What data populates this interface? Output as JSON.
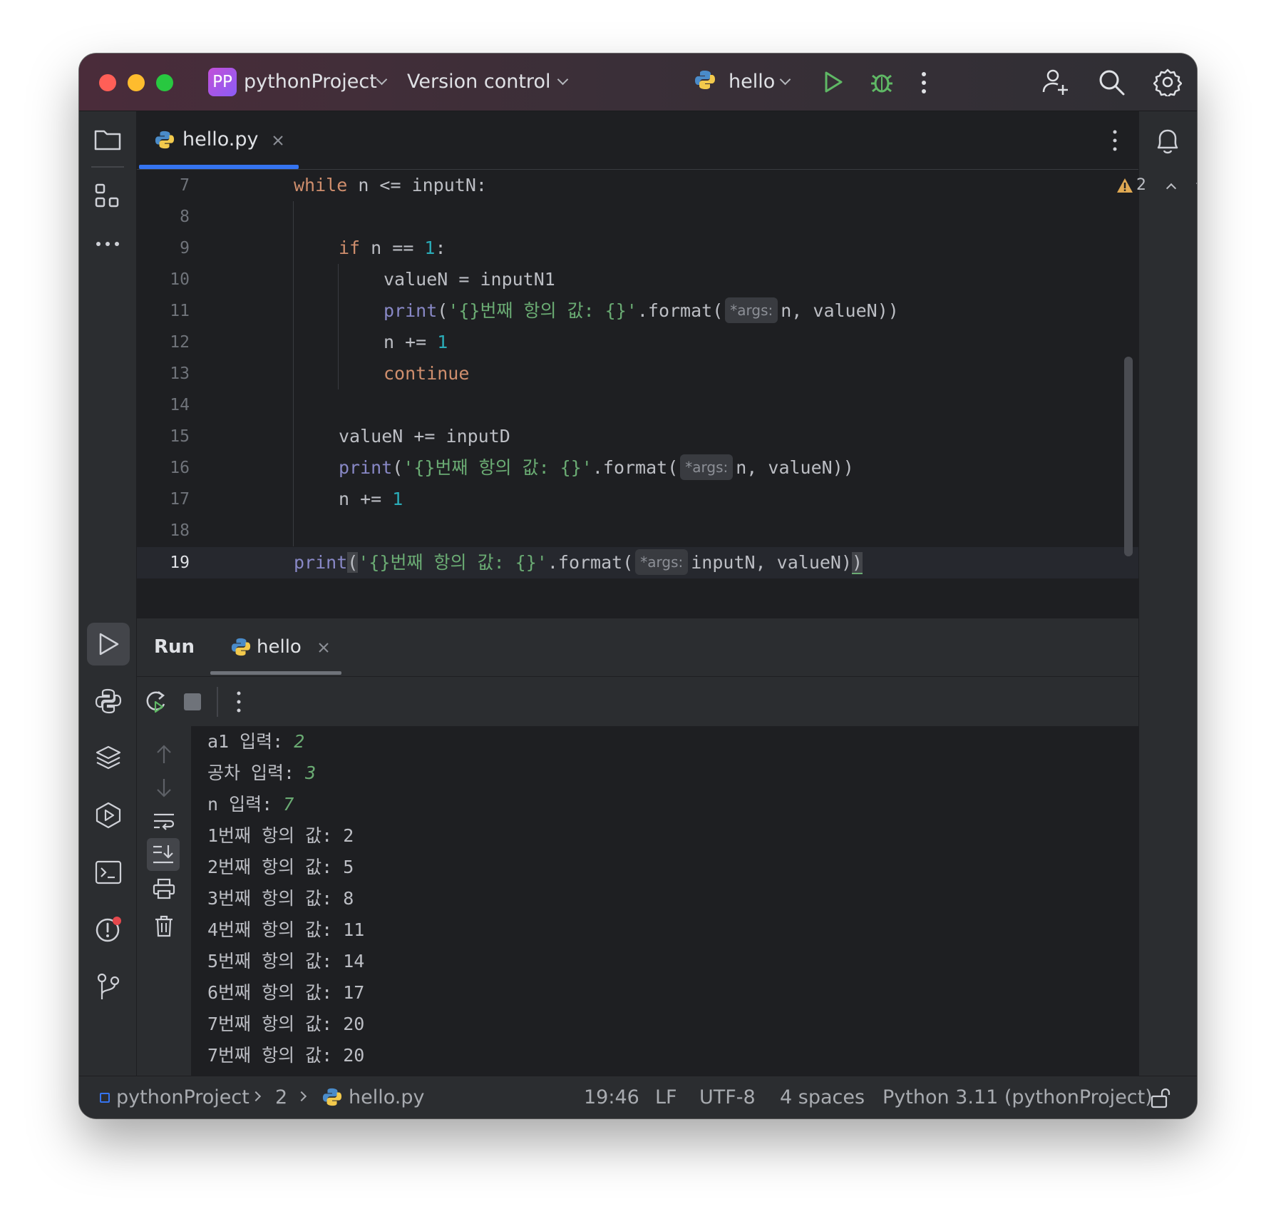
{
  "titlebar": {
    "project_badge": "PP",
    "project_name": "pythonProject",
    "vcs_label": "Version control",
    "run_config": "hello"
  },
  "editor": {
    "tab_label": "hello.py",
    "warning_count": "2",
    "line_numbers": [
      "7",
      "8",
      "9",
      "10",
      "11",
      "12",
      "13",
      "14",
      "15",
      "16",
      "17",
      "18",
      "19"
    ],
    "code": {
      "l7_kw": "while",
      "l7_rest": " n <= inputN:",
      "l9_kw": "if",
      "l9_mid": " n == ",
      "l9_num": "1",
      "l9_end": ":",
      "l10": "valueN = inputN1",
      "fn_print": "print",
      "paren_open": "(",
      "str_fmt": "'{}번째 항의 값: {}'",
      "dot_format": ".format(",
      "hint_args": "*args:",
      "l11_args": "n, valueN))",
      "l12_pre": "n += ",
      "l12_num": "1",
      "l13_kw": "continue",
      "l15": "valueN += inputD",
      "l16_args": "n, valueN))",
      "l17_pre": "n += ",
      "l17_num": "1",
      "l19_args": "inputN, valueN)",
      "l19_close": ")"
    }
  },
  "run_panel": {
    "title": "Run",
    "tab_label": "hello",
    "console": [
      {
        "prompt": "a1 입력: ",
        "input": "2"
      },
      {
        "prompt": "공차 입력: ",
        "input": "3"
      },
      {
        "prompt": "n 입력: ",
        "input": "7"
      },
      {
        "text": "1번째 항의 값: 2"
      },
      {
        "text": "2번째 항의 값: 5"
      },
      {
        "text": "3번째 항의 값: 8"
      },
      {
        "text": "4번째 항의 값: 11"
      },
      {
        "text": "5번째 항의 값: 14"
      },
      {
        "text": "6번째 항의 값: 17"
      },
      {
        "text": "7번째 항의 값: 20"
      },
      {
        "text": "7번째 항의 값: 20"
      }
    ]
  },
  "statusbar": {
    "project": "pythonProject",
    "crumb_mid": "2",
    "file": "hello.py",
    "cursor_pos": "19:46",
    "line_sep": "LF",
    "encoding": "UTF-8",
    "indent": "4 spaces",
    "interpreter": "Python 3.11 (pythonProject)"
  },
  "colors": {
    "accent": "#3574f0",
    "keyword": "#cf8e6d",
    "string": "#6aab73",
    "number": "#2aacb8",
    "builtin": "#8888c6",
    "run_green": "#5fb865"
  },
  "icons": [
    "folder-icon",
    "structure-icon",
    "more-icon",
    "run-icon",
    "python-console-icon",
    "layers-icon",
    "services-icon",
    "terminal-icon",
    "problems-icon",
    "git-icon",
    "debug-icon",
    "add-user-icon",
    "search-icon",
    "settings-icon",
    "bell-icon",
    "rerun-icon",
    "stop-icon",
    "scroll-up-icon",
    "scroll-down-icon",
    "soft-wrap-icon",
    "scroll-to-end-icon",
    "print-icon",
    "trash-icon",
    "lock-icon",
    "warning-icon",
    "python-file-icon"
  ]
}
